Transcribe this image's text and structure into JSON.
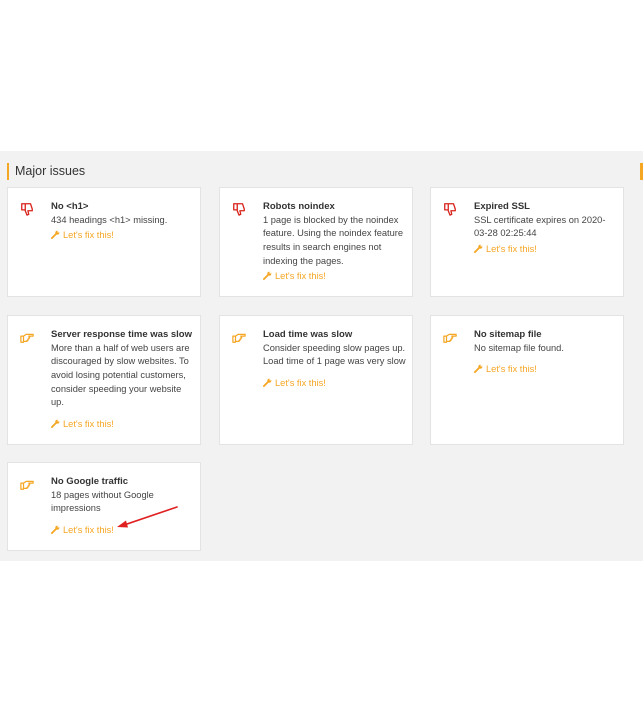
{
  "section": {
    "title": "Major issues"
  },
  "colors": {
    "accent": "#f5a623",
    "negative": "#d9231d",
    "warning": "#f5a623",
    "panel": "#f2f2f2"
  },
  "issues": [
    {
      "icon": "thumbs-down-icon",
      "title": "No <h1>",
      "description": "434 headings <h1> missing.",
      "link": "Let's fix this!"
    },
    {
      "icon": "thumbs-down-icon",
      "title": "Robots noindex",
      "description": "1 page is blocked by the noindex feature. Using the noindex feature results in search engines not indexing the pages.",
      "link": "Let's fix this!"
    },
    {
      "icon": "thumbs-down-icon",
      "title": "Expired SSL",
      "description": "SSL certificate expires on 2020-03-28 02:25:44",
      "link": "Let's fix this!"
    },
    {
      "icon": "pointing-hand-icon",
      "title": "Server response time was slow",
      "description": "More than a half of web users are discouraged by slow websites. To avoid losing potential customers, consider speeding your website up.",
      "link": "Let's fix this!"
    },
    {
      "icon": "pointing-hand-icon",
      "title": "Load time was slow",
      "description": "Consider speeding slow pages up. Load time of 1 page was very slow",
      "link": "Let's fix this!"
    },
    {
      "icon": "pointing-hand-icon",
      "title": "No sitemap file",
      "description": "No sitemap file found.",
      "link": "Let's fix this!"
    },
    {
      "icon": "pointing-hand-icon",
      "title": "No Google traffic",
      "description": "18 pages without Google impressions",
      "link": "Let's fix this!"
    }
  ]
}
